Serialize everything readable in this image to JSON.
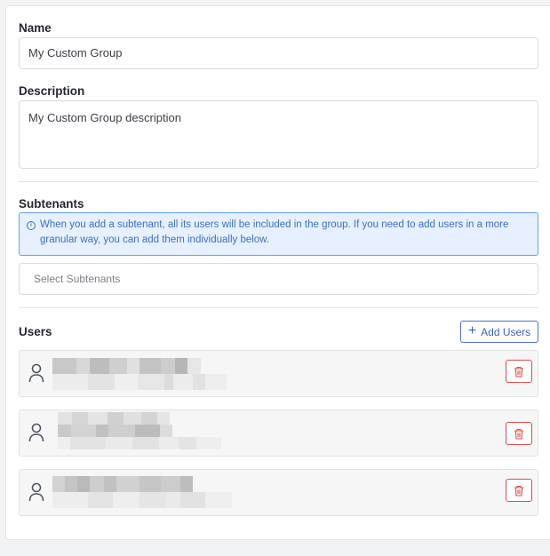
{
  "form": {
    "name_label": "Name",
    "name_value": "My Custom Group",
    "description_label": "Description",
    "description_value": "My Custom Group description",
    "subtenants_label": "Subtenants",
    "subtenants_info": "When you add a subtenant, all its users will be included in the group. If you need to add users in a more granular way, you can add them individually below.",
    "subtenants_placeholder": "Select Subtenants",
    "users_label": "Users",
    "add_users_label": "Add Users"
  },
  "users": [
    {
      "name": "redacted",
      "email": "redacted"
    },
    {
      "name": "redacted",
      "email": "redacted"
    },
    {
      "name": "redacted",
      "email": "redacted"
    }
  ],
  "colors": {
    "accent": "#3f5fc9",
    "info_bg": "#e7f0fe",
    "info_border": "#6aa0ef",
    "danger": "#de4a4a"
  },
  "icons": {
    "info": "info-icon",
    "add": "plus-icon",
    "user": "user-icon",
    "delete": "trash-icon"
  }
}
